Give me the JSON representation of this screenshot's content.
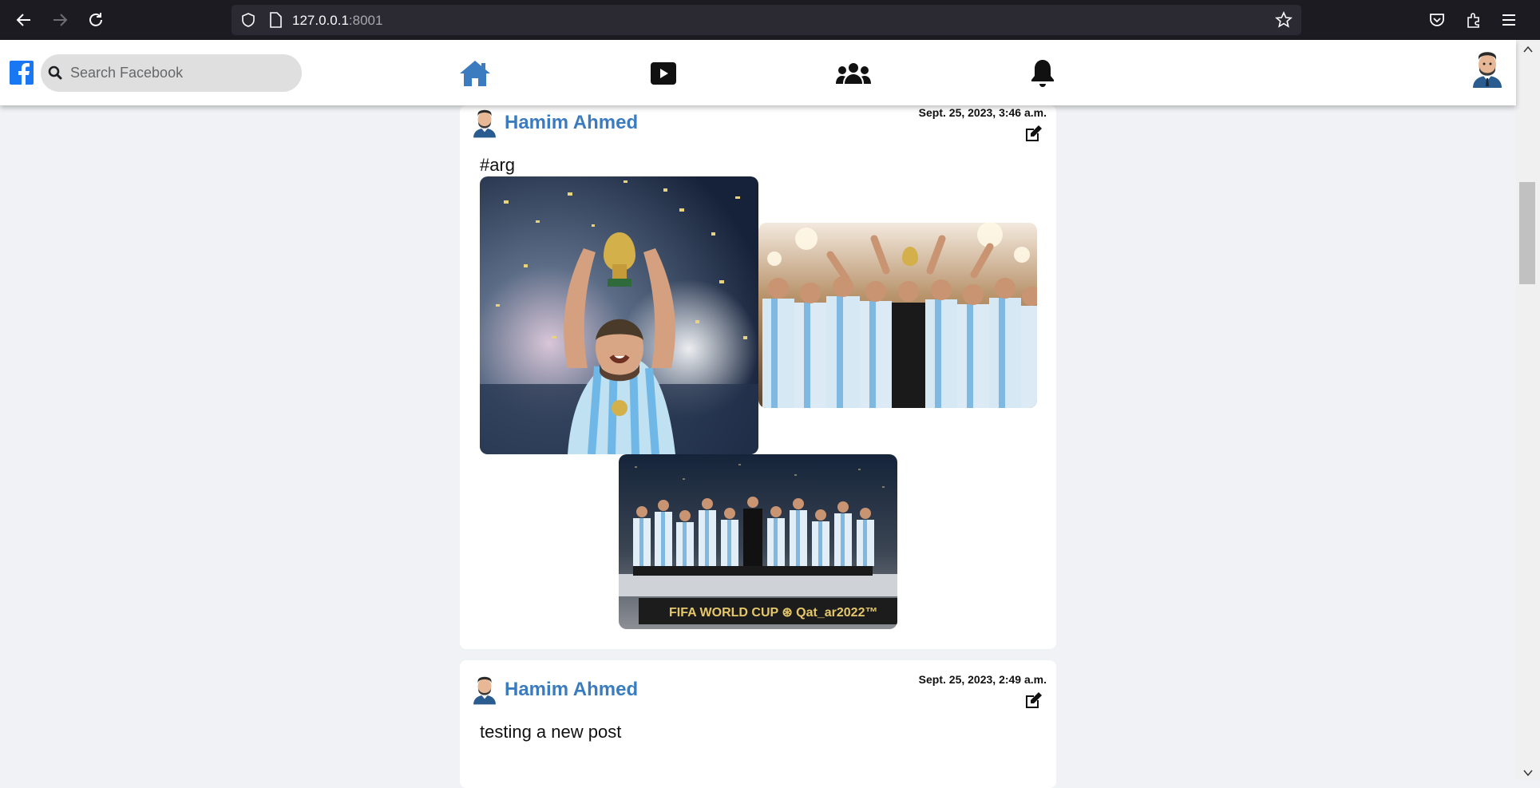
{
  "browser": {
    "url_host": "127.0.0.1",
    "url_port": ":8001"
  },
  "header": {
    "search_placeholder": "Search Facebook",
    "icons": [
      "facebook-logo-icon",
      "search-icon",
      "home-icon",
      "video-icon",
      "groups-icon",
      "bell-icon"
    ],
    "accent_color": "#3b7bbf"
  },
  "posts": [
    {
      "author": "Hamim Ahmed",
      "date": "Sept. 25, 2023, 3:46 a.m.",
      "text": "#arg",
      "banner_text": "FIFA WORLD CUP ⊛ Qat_ar2022™"
    },
    {
      "author": "Hamim Ahmed",
      "date": "Sept. 25, 2023, 2:49 a.m.",
      "text": "testing a new post"
    }
  ]
}
